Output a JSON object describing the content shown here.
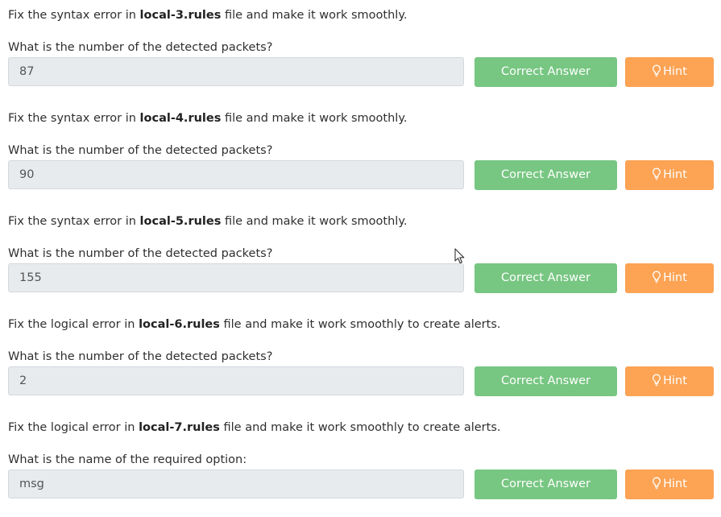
{
  "tasks": [
    {
      "pre": "Fix the syntax error in ",
      "file": "local-3.rules",
      "post": " file and make it work smoothly.",
      "question": "What is the number of the detected packets?",
      "answer": "87",
      "correct_label": "Correct Answer",
      "hint_label": "Hint"
    },
    {
      "pre": "Fix the syntax error in ",
      "file": "local-4.rules",
      "post": " file and make it work smoothly.",
      "question": "What is the number of the detected packets?",
      "answer": "90",
      "correct_label": "Correct Answer",
      "hint_label": "Hint"
    },
    {
      "pre": "Fix the syntax error in ",
      "file": "local-5.rules",
      "post": " file and make it work smoothly.",
      "question": "What is the number of the detected packets?",
      "answer": "155",
      "correct_label": "Correct Answer",
      "hint_label": "Hint"
    },
    {
      "pre": "Fix the logical error in ",
      "file": "local-6.rules",
      "post": " file and make it work smoothly to create alerts.",
      "question": "What is the number of the detected packets?",
      "answer": "2",
      "correct_label": "Correct Answer",
      "hint_label": "Hint"
    },
    {
      "pre": "Fix the logical error in ",
      "file": "local-7.rules",
      "post": " file and make it work smoothly to create alerts.",
      "question": "What is the name of the required option:",
      "answer": "msg",
      "correct_label": "Correct Answer",
      "hint_label": "Hint"
    }
  ],
  "colors": {
    "correct_button": "#77c682",
    "hint_button": "#fca354",
    "answer_field_bg": "#e8ebee"
  },
  "icons": {
    "hint": "lightbulb-icon",
    "pointer": "mouse-cursor-icon"
  }
}
